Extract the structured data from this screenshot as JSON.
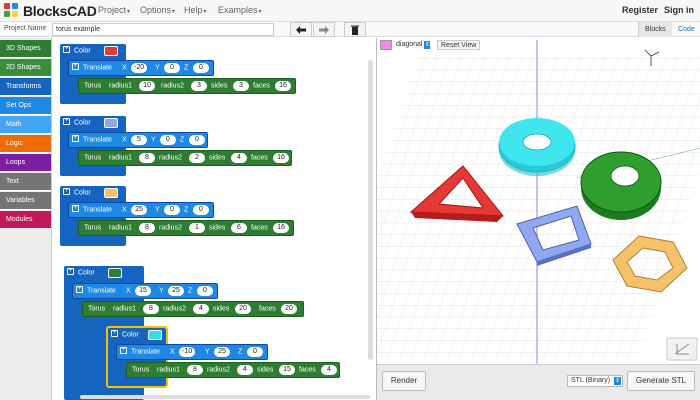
{
  "header": {
    "app_name": "BlocksCAD",
    "menus": [
      "Project",
      "Options",
      "Help",
      "Examples"
    ],
    "register": "Register",
    "signin": "Sign in"
  },
  "project": {
    "label": "Project Name",
    "value": "torus example"
  },
  "tabs": {
    "blocks": "Blocks",
    "code": "Code"
  },
  "categories": [
    {
      "label": "3D Shapes",
      "color": "#2e7d32"
    },
    {
      "label": "2D Shapes",
      "color": "#388e3c"
    },
    {
      "label": "Transforms",
      "color": "#1565c0"
    },
    {
      "label": "Set Ops",
      "color": "#1e88e5"
    },
    {
      "label": "Math",
      "color": "#42a5f5"
    },
    {
      "label": "Logic",
      "color": "#ef6c00"
    },
    {
      "label": "Loops",
      "color": "#7b1fa2"
    },
    {
      "label": "Text",
      "color": "#757575"
    },
    {
      "label": "Variables",
      "color": "#757575"
    },
    {
      "label": "Modules",
      "color": "#c2185b"
    }
  ],
  "labels": {
    "color": "Color",
    "translate": "Translate",
    "x": "X",
    "y": "Y",
    "z": "Z",
    "torus": "Torus",
    "radius1": "radius1",
    "radius2": "radius2",
    "sides": "sides",
    "faces": "faces"
  },
  "groups": [
    {
      "color": "#e53935",
      "tx": "-20",
      "ty": "0",
      "tz": "0",
      "r1": "10",
      "r2": "3",
      "sides": "3",
      "faces": "16"
    },
    {
      "color": "#8fa8f0",
      "tx": "5",
      "ty": "0",
      "tz": "0",
      "r1": "8",
      "r2": "2",
      "sides": "4",
      "faces": "16"
    },
    {
      "color": "#f5c26b",
      "tx": "25",
      "ty": "0",
      "tz": "0",
      "r1": "8",
      "r2": "1",
      "sides": "6",
      "faces": "16"
    },
    {
      "color": "#2e7d32",
      "tx": "15",
      "ty": "25",
      "tz": "0",
      "r1": "8",
      "r2": "4",
      "sides": "20",
      "faces": "20"
    },
    {
      "color": "#33dde8",
      "tx": "-10",
      "ty": "25",
      "tz": "0",
      "r1": "8",
      "r2": "4",
      "sides": "15",
      "faces": "4"
    }
  ],
  "viewer": {
    "view_option": "diagonal",
    "reset_view": "Reset View",
    "render": "Render",
    "format": "STL (Binary)",
    "generate": "Generate STL"
  }
}
